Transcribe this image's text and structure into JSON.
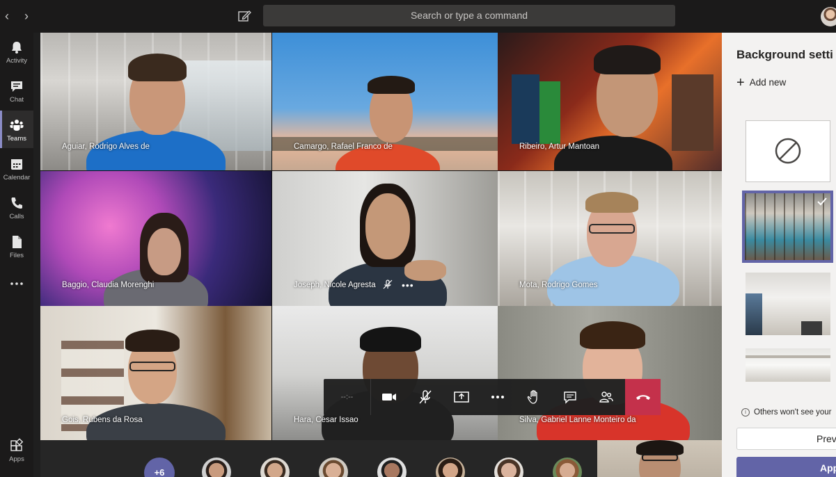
{
  "topbar": {
    "search_placeholder": "Search or type a command",
    "back_icon": "chevron-left-icon",
    "forward_icon": "chevron-right-icon",
    "compose_icon": "compose-icon"
  },
  "rail": {
    "items": [
      {
        "label": "Activity",
        "icon": "bell-icon"
      },
      {
        "label": "Chat",
        "icon": "chat-icon"
      },
      {
        "label": "Teams",
        "icon": "teams-icon",
        "active": true
      },
      {
        "label": "Calendar",
        "icon": "calendar-icon"
      },
      {
        "label": "Calls",
        "icon": "phone-icon"
      },
      {
        "label": "Files",
        "icon": "file-icon"
      },
      {
        "label": "",
        "icon": "more-icon"
      }
    ],
    "apps_label": "Apps"
  },
  "participants": [
    {
      "name": "Aguiar, Rodrigo Alves de"
    },
    {
      "name": "Camargo, Rafael Franco de"
    },
    {
      "name": "Ribeiro, Artur Mantoan"
    },
    {
      "name": "Baggio, Claudia Morenghi"
    },
    {
      "name": "Joseph, Nicole Agresta"
    },
    {
      "name": "Mota, Rodrigo Gomes"
    },
    {
      "name": "Gois, Rubens da Rosa"
    },
    {
      "name": "Hara, Cesar Issao"
    },
    {
      "name": "Silva, Gabriel Lanne Monteiro da"
    }
  ],
  "controls": {
    "timer": "--:--",
    "buttons": [
      "camera-icon",
      "mic-off-icon",
      "share-screen-icon",
      "more-icon",
      "raise-hand-icon",
      "chat-icon",
      "participants-icon",
      "hang-up-icon"
    ]
  },
  "strip": {
    "overflow_count": "+6"
  },
  "panel": {
    "title": "Background setti",
    "add_new": "Add new",
    "notice": "Others won't see your",
    "preview_label": "Prev",
    "apply_label": "App"
  },
  "colors": {
    "accent": "#6264a7",
    "hangup": "#c4314b",
    "rail_bg": "#1b1a1a"
  }
}
